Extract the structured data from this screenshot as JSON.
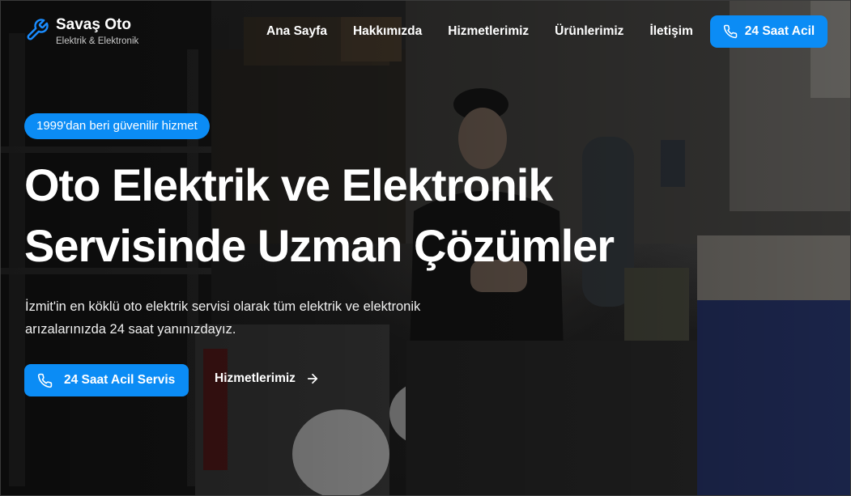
{
  "brand": {
    "name": "Savaş Oto",
    "tagline": "Elektrik & Elektronik",
    "icon": "wrench-icon"
  },
  "nav": {
    "items": [
      {
        "label": "Ana Sayfa"
      },
      {
        "label": "Hakkımızda"
      },
      {
        "label": "Hizmetlerimiz"
      },
      {
        "label": "Ürünlerimiz"
      },
      {
        "label": "İletişim"
      }
    ],
    "emergency_button": {
      "label": "24 Saat Acil",
      "icon": "phone-icon"
    }
  },
  "hero": {
    "badge": "1999'dan beri güvenilir hizmet",
    "headline_line1": "Oto Elektrik ve Elektronik",
    "headline_line2": "Servisinde Uzman Çözümler",
    "subtext": "İzmit'in en köklü oto elektrik servisi olarak tüm elektrik ve elektronik arızalarınızda 24 saat yanınızdayız.",
    "primary_cta": {
      "label": "24 Saat Acil Servis",
      "icon": "phone-icon"
    },
    "secondary_cta": {
      "label": "Hizmetlerimiz",
      "icon": "arrow-right-icon"
    }
  },
  "colors": {
    "accent": "#0b8cf5",
    "text": "#ffffff"
  }
}
